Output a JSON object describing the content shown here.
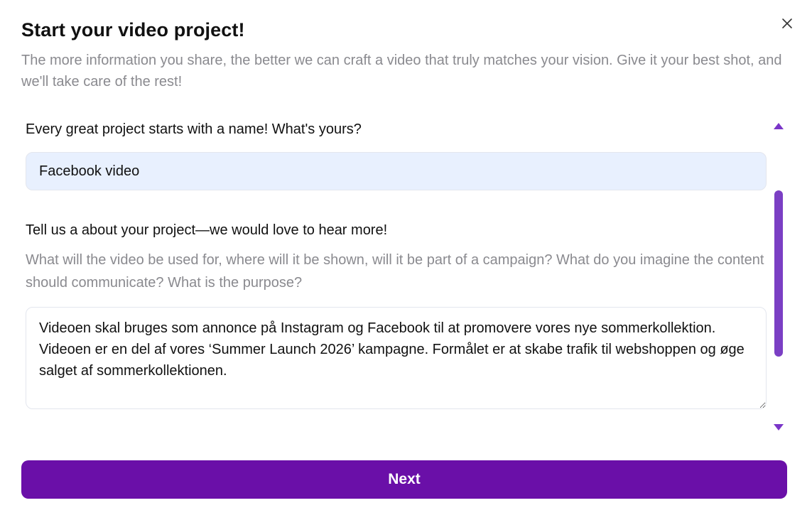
{
  "dialog": {
    "title": "Start your video project!",
    "subtitle": "The more information you share, the better we can craft a video that truly matches your vision. Give it your best shot, and we'll take care of the rest!",
    "close_icon": "close-icon"
  },
  "form": {
    "name_label": "Every great project starts with a name! What's yours?",
    "name_value": "Facebook video",
    "about_label": "Tell us a about your project—we would love to hear more!",
    "about_help": "What will the video be used for, where will it be shown, will it be part of a campaign? What do you imagine the content should communicate? What is the purpose?",
    "about_value": "Videoen skal bruges som annonce på Instagram og Facebook til at promovere vores nye sommerkollektion.  Videoen er en del af vores ‘Summer Launch 2026’ kampagne. Formålet er at skabe trafik til webshoppen og øge salget af sommerkollektionen."
  },
  "actions": {
    "next_label": "Next"
  },
  "colors": {
    "accent": "#6a0fa8",
    "scrollbar": "#7b3fc4",
    "input_fill": "#e8f0fe"
  }
}
